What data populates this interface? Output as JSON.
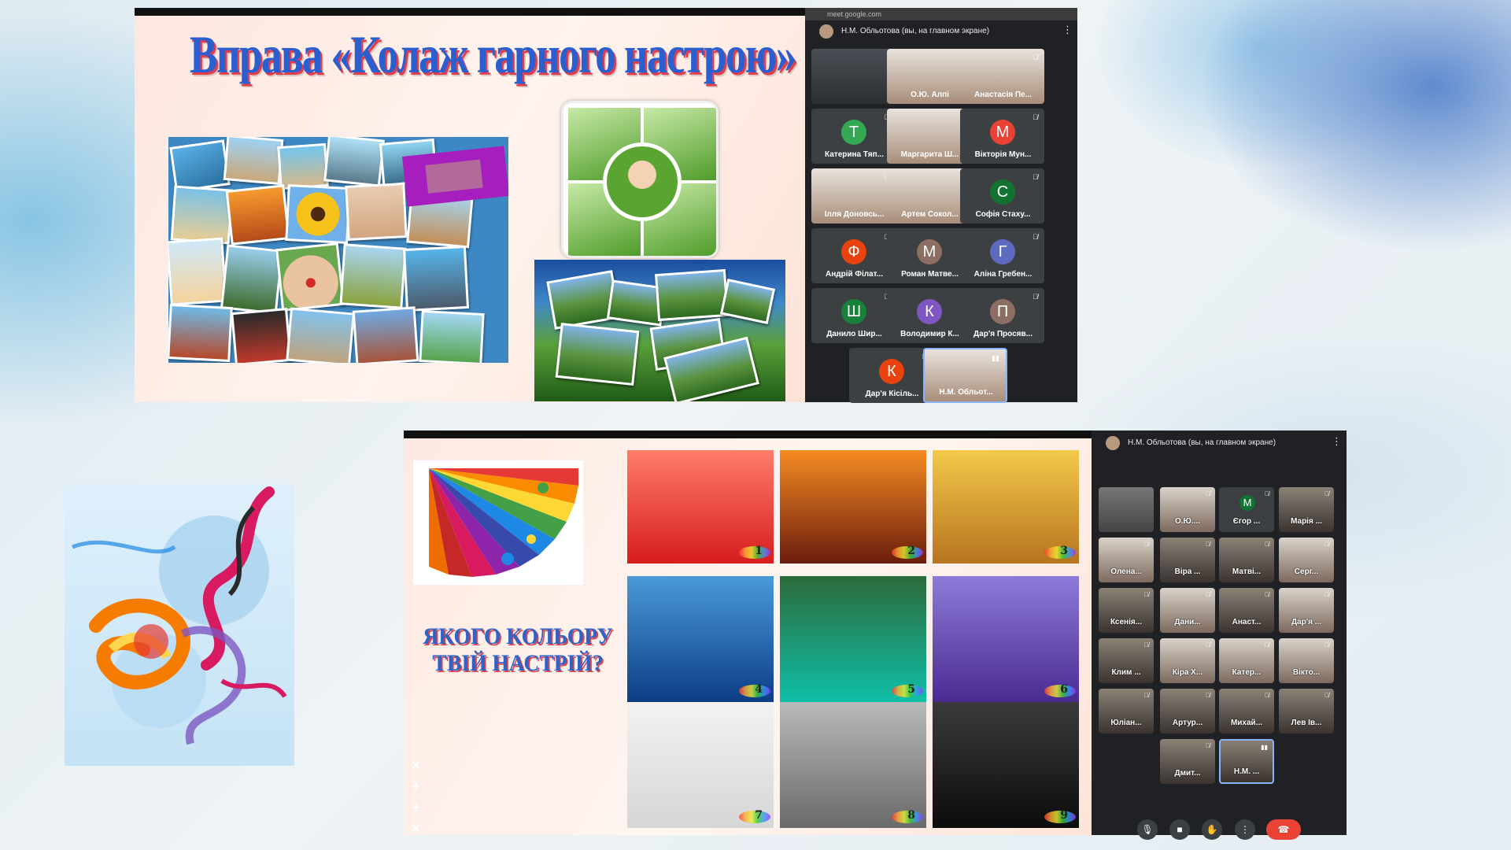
{
  "slide1": {
    "title": "Вправа «Колаж гарного настрою»",
    "meet": {
      "url": "meet.google.com",
      "presenter": "Н.М. Обльотова (вы, на главном экране)",
      "participants": [
        {
          "name": "О.Ю. Алпі",
          "initial": "",
          "color": ""
        },
        {
          "name": "Анастасія Пе...",
          "initial": "",
          "color": ""
        },
        {
          "name": "Катерина Тяп...",
          "initial": "Т",
          "color": "#34a853"
        },
        {
          "name": "Маргарита Ш...",
          "initial": "",
          "color": ""
        },
        {
          "name": "Вікторія Мун...",
          "initial": "М",
          "color": "#ea4335"
        },
        {
          "name": "Ілля Доновсь...",
          "initial": "",
          "color": ""
        },
        {
          "name": "Артем Сокол...",
          "initial": "",
          "color": ""
        },
        {
          "name": "Софія Стаху...",
          "initial": "С",
          "color": "#137333"
        },
        {
          "name": "Андрій Філат...",
          "initial": "Ф",
          "color": "#e8430d"
        },
        {
          "name": "Роман Матве...",
          "initial": "М",
          "color": "#8d6e63"
        },
        {
          "name": "Аліна Гребен...",
          "initial": "Г",
          "color": "#5c6bc0"
        },
        {
          "name": "Данило Шир...",
          "initial": "Ш",
          "color": "#188038"
        },
        {
          "name": "Володимир К...",
          "initial": "К",
          "color": "#7e57c2"
        },
        {
          "name": "Дар'я Просяв...",
          "initial": "П",
          "color": "#8d6e63"
        },
        {
          "name": "Дар'я Кісіль...",
          "initial": "К",
          "color": "#e8430d"
        },
        {
          "name": "Н.М. Обльот...",
          "initial": "",
          "color": ""
        }
      ]
    }
  },
  "slide2": {
    "title_line1": "ЯКОГО КОЛЬОРУ",
    "title_line2": "ТВІЙ НАСТРІЙ?",
    "cells": [
      {
        "num": "1",
        "colors": [
          "#ff7d6a",
          "#d61d1d"
        ]
      },
      {
        "num": "2",
        "colors": [
          "#f58b22",
          "#6b1d0d"
        ]
      },
      {
        "num": "3",
        "colors": [
          "#f3c94a",
          "#b7741f"
        ]
      },
      {
        "num": "4",
        "colors": [
          "#4a9ad8",
          "#0c3d86"
        ]
      },
      {
        "num": "5",
        "colors": [
          "#2c6a3a",
          "#0fbfa8"
        ]
      },
      {
        "num": "6",
        "colors": [
          "#8d7bd9",
          "#4a2a91"
        ]
      },
      {
        "num": "7",
        "colors": [
          "#f2f2f2",
          "#d6d6d6"
        ]
      },
      {
        "num": "8",
        "colors": [
          "#b9b9b9",
          "#6a6a6a"
        ]
      },
      {
        "num": "9",
        "colors": [
          "#3a3a3a",
          "#0c0c0c"
        ]
      }
    ],
    "meet": {
      "presenter": "Н.М. Обльотова (вы, на главном экране)",
      "participants": [
        {
          "name": "",
          "type": "screen"
        },
        {
          "name": "О.Ю....",
          "type": "light"
        },
        {
          "name": "Єгор ...",
          "type": "avatar",
          "initial": "М"
        },
        {
          "name": "Марія ...",
          "type": "dark"
        },
        {
          "name": "Олена...",
          "type": "light"
        },
        {
          "name": "Віра ...",
          "type": "photo"
        },
        {
          "name": "Матві...",
          "type": "photo"
        },
        {
          "name": "Серг...",
          "type": "light"
        },
        {
          "name": "Ксенія...",
          "type": "photo"
        },
        {
          "name": "Дани...",
          "type": "light"
        },
        {
          "name": "Анаст...",
          "type": "photo"
        },
        {
          "name": "Дар'я ...",
          "type": "light"
        },
        {
          "name": "Клим ...",
          "type": "dark"
        },
        {
          "name": "Кіра Х...",
          "type": "light"
        },
        {
          "name": "Катер...",
          "type": "light"
        },
        {
          "name": "Вікто...",
          "type": "light"
        },
        {
          "name": "Юліан...",
          "type": "dark"
        },
        {
          "name": "Артур...",
          "type": "photo"
        },
        {
          "name": "Михай...",
          "type": "photo"
        },
        {
          "name": "Лев Ів...",
          "type": "dark"
        },
        {
          "name": "Дмит...",
          "type": "photo"
        },
        {
          "name": "Н.М. ...",
          "type": "active"
        }
      ],
      "controls": [
        "mic-icon",
        "camera-icon",
        "hand-icon",
        "more-icon",
        "end-call-icon"
      ]
    }
  }
}
